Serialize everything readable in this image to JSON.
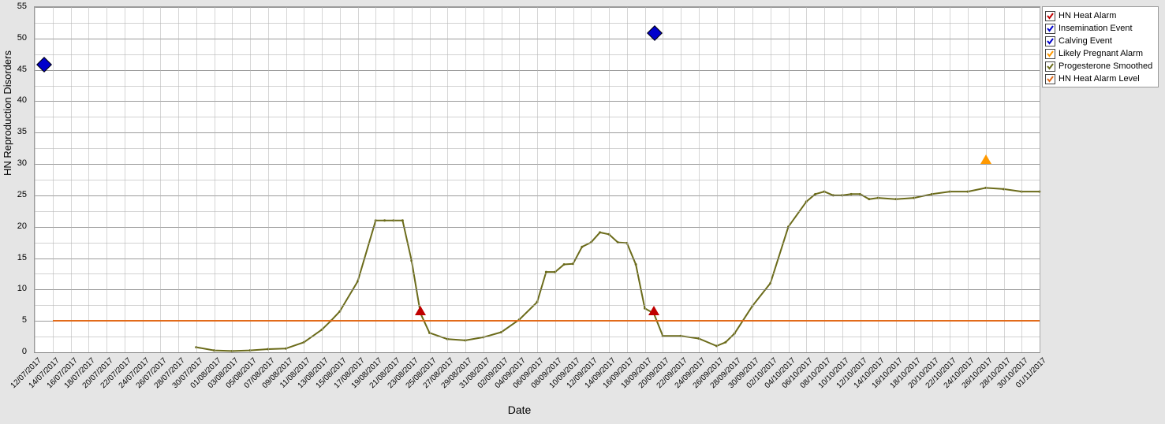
{
  "chart_data": {
    "type": "line",
    "xlabel": "Date",
    "ylabel": "HN Reproduction Disorders",
    "ylim": [
      0,
      55
    ],
    "x_start": "12/07/2017",
    "x_end": "01/11/2017",
    "x_ticks": [
      "12/07/2017",
      "14/07/2017",
      "16/07/2017",
      "18/07/2017",
      "20/07/2017",
      "22/07/2017",
      "24/07/2017",
      "26/07/2017",
      "28/07/2017",
      "30/07/2017",
      "01/08/2017",
      "03/08/2017",
      "05/08/2017",
      "07/08/2017",
      "09/08/2017",
      "11/08/2017",
      "13/08/2017",
      "15/08/2017",
      "17/08/2017",
      "19/08/2017",
      "21/08/2017",
      "23/08/2017",
      "25/08/2017",
      "27/08/2017",
      "29/08/2017",
      "31/08/2017",
      "02/09/2017",
      "04/09/2017",
      "06/09/2017",
      "08/09/2017",
      "10/09/2017",
      "12/09/2017",
      "14/09/2017",
      "16/09/2017",
      "18/09/2017",
      "20/09/2017",
      "22/09/2017",
      "24/09/2017",
      "26/09/2017",
      "28/09/2017",
      "30/09/2017",
      "02/10/2017",
      "04/10/2017",
      "06/10/2017",
      "08/10/2017",
      "10/10/2017",
      "12/10/2017",
      "14/10/2017",
      "16/10/2017",
      "18/10/2017",
      "20/10/2017",
      "22/10/2017",
      "24/10/2017",
      "26/10/2017",
      "28/10/2017",
      "30/10/2017",
      "01/11/2017"
    ],
    "y_ticks": [
      0,
      5,
      10,
      15,
      20,
      25,
      30,
      35,
      40,
      45,
      50,
      55
    ],
    "series": [
      {
        "name": "Progesterone Smoothed",
        "color": "#6b6b1a",
        "type": "line",
        "data": [
          [
            "30/07/2017",
            0.8
          ],
          [
            "01/08/2017",
            0.3
          ],
          [
            "03/08/2017",
            0.2
          ],
          [
            "05/08/2017",
            0.3
          ],
          [
            "07/08/2017",
            0.5
          ],
          [
            "09/08/2017",
            0.6
          ],
          [
            "11/08/2017",
            1.6
          ],
          [
            "13/08/2017",
            3.6
          ],
          [
            "14/08/2017",
            5.0
          ],
          [
            "15/08/2017",
            6.5
          ],
          [
            "17/08/2017",
            11.3
          ],
          [
            "19/08/2017",
            21.0
          ],
          [
            "20/08/2017",
            21.0
          ],
          [
            "21/08/2017",
            21.0
          ],
          [
            "22/08/2017",
            21.0
          ],
          [
            "23/08/2017",
            14.6
          ],
          [
            "24/08/2017",
            6.2
          ],
          [
            "25/08/2017",
            3.1
          ],
          [
            "27/08/2017",
            2.1
          ],
          [
            "29/08/2017",
            1.9
          ],
          [
            "31/08/2017",
            2.4
          ],
          [
            "02/09/2017",
            3.2
          ],
          [
            "04/09/2017",
            5.2
          ],
          [
            "06/09/2017",
            8.0
          ],
          [
            "07/09/2017",
            12.8
          ],
          [
            "08/09/2017",
            12.8
          ],
          [
            "09/09/2017",
            14.0
          ],
          [
            "10/09/2017",
            14.1
          ],
          [
            "11/09/2017",
            16.8
          ],
          [
            "12/09/2017",
            17.5
          ],
          [
            "13/09/2017",
            19.1
          ],
          [
            "14/09/2017",
            18.8
          ],
          [
            "15/09/2017",
            17.5
          ],
          [
            "16/09/2017",
            17.4
          ],
          [
            "17/09/2017",
            14.0
          ],
          [
            "18/09/2017",
            7.0
          ],
          [
            "19/09/2017",
            6.2
          ],
          [
            "20/09/2017",
            2.6
          ],
          [
            "22/09/2017",
            2.6
          ],
          [
            "24/09/2017",
            2.2
          ],
          [
            "26/09/2017",
            1.0
          ],
          [
            "27/09/2017",
            1.6
          ],
          [
            "28/09/2017",
            3.0
          ],
          [
            "30/09/2017",
            7.4
          ],
          [
            "02/10/2017",
            11.0
          ],
          [
            "04/10/2017",
            20.0
          ],
          [
            "06/10/2017",
            24.0
          ],
          [
            "07/10/2017",
            25.2
          ],
          [
            "08/10/2017",
            25.6
          ],
          [
            "09/10/2017",
            25.0
          ],
          [
            "10/10/2017",
            25.0
          ],
          [
            "11/10/2017",
            25.2
          ],
          [
            "12/10/2017",
            25.2
          ],
          [
            "13/10/2017",
            24.4
          ],
          [
            "14/10/2017",
            24.6
          ],
          [
            "16/10/2017",
            24.4
          ],
          [
            "18/10/2017",
            24.6
          ],
          [
            "20/10/2017",
            25.2
          ],
          [
            "22/10/2017",
            25.6
          ],
          [
            "24/10/2017",
            25.6
          ],
          [
            "26/10/2017",
            26.2
          ],
          [
            "28/10/2017",
            26.0
          ],
          [
            "30/10/2017",
            25.6
          ],
          [
            "01/11/2017",
            25.6
          ]
        ]
      },
      {
        "name": "HN Heat Alarm Level",
        "color": "#e26b1a",
        "type": "hline",
        "y": 5,
        "x_from": "14/07/2017",
        "x_to": "01/11/2017"
      },
      {
        "name": "HN Heat Alarm",
        "color": "#c00000",
        "type": "marker",
        "shape": "triangle-up",
        "data": [
          [
            "24/08/2017",
            6.2
          ],
          [
            "19/09/2017",
            6.2
          ]
        ]
      },
      {
        "name": "Insemination Event",
        "color": "#0000cc",
        "type": "marker",
        "shape": "diamond",
        "data": [
          [
            "13/07/2017",
            46
          ],
          [
            "19/09/2017",
            51
          ]
        ]
      },
      {
        "name": "Calving Event",
        "color": "#0000cc",
        "type": "marker",
        "shape": "diamond",
        "data": []
      },
      {
        "name": "Likely Pregnant Alarm",
        "color": "#ff9900",
        "type": "marker",
        "shape": "triangle-up",
        "data": [
          [
            "26/10/2017",
            30.2
          ]
        ]
      }
    ]
  },
  "legend": {
    "items": [
      {
        "label": "HN Heat Alarm",
        "check_color": "#c00000"
      },
      {
        "label": "Insemination Event",
        "check_color": "#0000cc"
      },
      {
        "label": "Calving Event",
        "check_color": "#0000cc"
      },
      {
        "label": "Likely Pregnant Alarm",
        "check_color": "#ff9900"
      },
      {
        "label": "Progesterone Smoothed",
        "check_color": "#6b6b1a"
      },
      {
        "label": "HN Heat Alarm Level",
        "check_color": "#e26b1a"
      }
    ]
  },
  "axis": {
    "xlabel": "Date",
    "ylabel": "HN Reproduction Disorders"
  }
}
